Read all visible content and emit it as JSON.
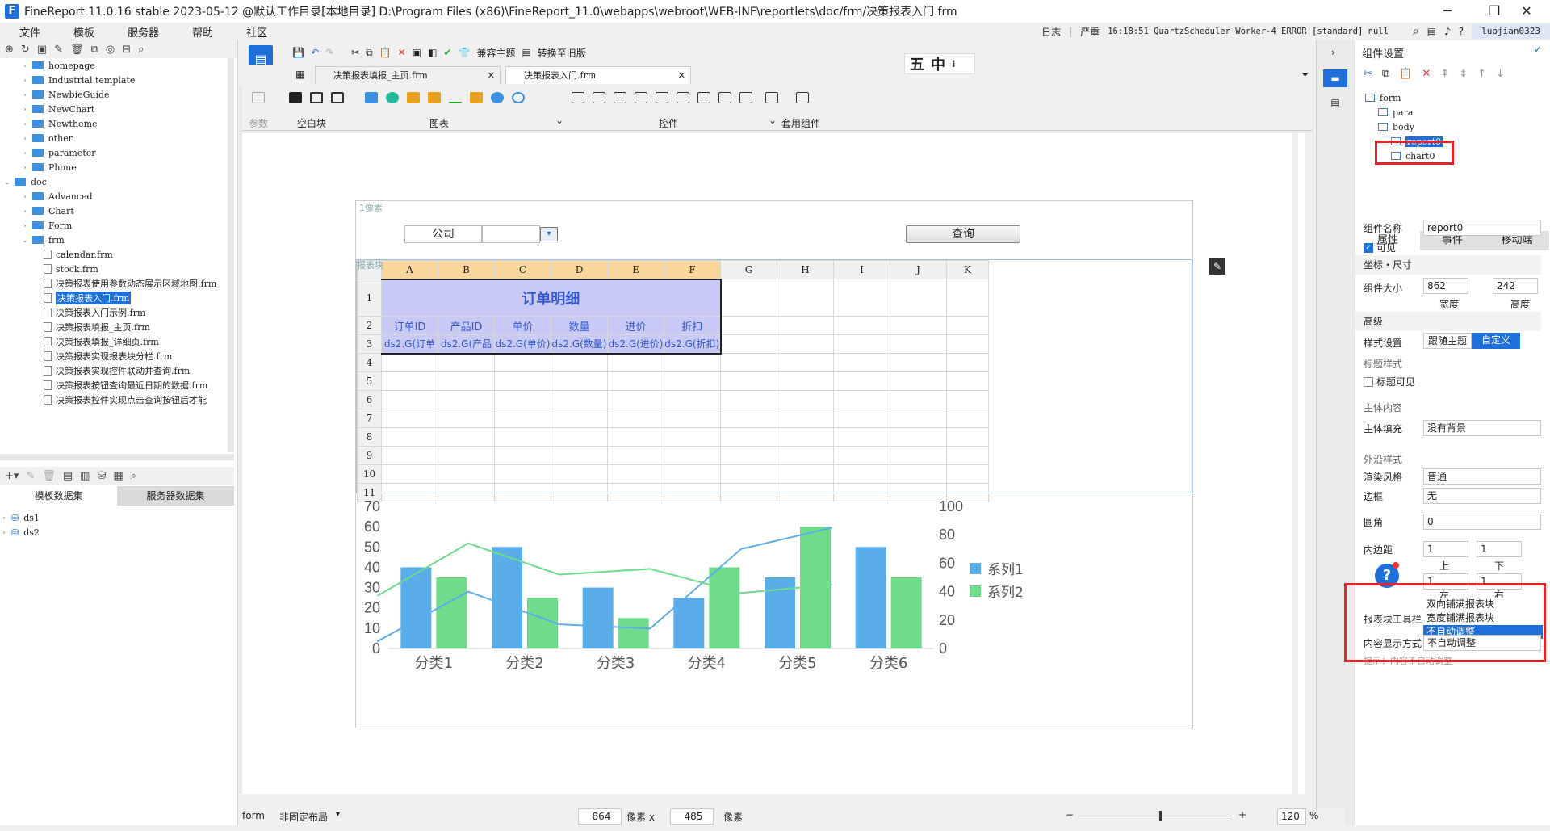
{
  "window": {
    "title": "FineReport 11.0.16 stable 2023-05-12 @默认工作目录[本地目录]    D:\\Program Files (x86)\\FineReport_11.0\\webapps\\webroot\\WEB-INF\\reportlets\\doc/frm/决策报表入门.frm",
    "logo": "F"
  },
  "menu": {
    "items": [
      "文件",
      "模板",
      "服务器",
      "帮助",
      "社区"
    ],
    "log_label": "日志",
    "severity": "严重",
    "log_text": "16:18:51 QuartzScheduler_Worker-4 ERROR [standard] null",
    "user": "luojian0323"
  },
  "tree": {
    "items": [
      {
        "label": "homepage",
        "type": "folder",
        "indent": 1,
        "expanded": false
      },
      {
        "label": "Industrial template",
        "type": "folder",
        "indent": 1,
        "expanded": false
      },
      {
        "label": "NewbieGuide",
        "type": "folder",
        "indent": 1,
        "expanded": false
      },
      {
        "label": "NewChart",
        "type": "folder",
        "indent": 1,
        "expanded": false
      },
      {
        "label": "Newtheme",
        "type": "folder",
        "indent": 1,
        "expanded": false
      },
      {
        "label": "other",
        "type": "folder",
        "indent": 1,
        "expanded": false
      },
      {
        "label": "parameter",
        "type": "folder",
        "indent": 1,
        "expanded": false
      },
      {
        "label": "Phone",
        "type": "folder",
        "indent": 1,
        "expanded": false
      },
      {
        "label": "doc",
        "type": "folder",
        "indent": 0,
        "expanded": true
      },
      {
        "label": "Advanced",
        "type": "folder",
        "indent": 1,
        "expanded": false
      },
      {
        "label": "Chart",
        "type": "folder",
        "indent": 1,
        "expanded": false
      },
      {
        "label": "Form",
        "type": "folder",
        "indent": 1,
        "expanded": false
      },
      {
        "label": "frm",
        "type": "folder",
        "indent": 1,
        "expanded": true
      },
      {
        "label": "calendar.frm",
        "type": "file",
        "indent": 2
      },
      {
        "label": "stock.frm",
        "type": "file",
        "indent": 2
      },
      {
        "label": "决策报表使用参数动态展示区域地图.frm",
        "type": "file",
        "indent": 2
      },
      {
        "label": "决策报表入门.frm",
        "type": "file",
        "indent": 2,
        "selected": true
      },
      {
        "label": "决策报表入门示例.frm",
        "type": "file",
        "indent": 2
      },
      {
        "label": "决策报表填报_主页.frm",
        "type": "file",
        "indent": 2
      },
      {
        "label": "决策报表填报_详细页.frm",
        "type": "file",
        "indent": 2
      },
      {
        "label": "决策报表实现报表块分栏.frm",
        "type": "file",
        "indent": 2
      },
      {
        "label": "决策报表实现控件联动并查询.frm",
        "type": "file",
        "indent": 2
      },
      {
        "label": "决策报表按钮查询最近日期的数据.frm",
        "type": "file",
        "indent": 2
      },
      {
        "label": "决策报表控件实现点击查询按钮后才能",
        "type": "file",
        "indent": 2
      }
    ]
  },
  "datasets": {
    "tabs": [
      "模板数据集",
      "服务器数据集"
    ],
    "items": [
      "ds1",
      "ds2"
    ]
  },
  "toolbar": {
    "theme_label": "兼容主题",
    "convert_label": "转换至旧版"
  },
  "doc_tabs": [
    "决策报表填报_主页.frm",
    "决策报表入门.frm"
  ],
  "ime": [
    "五",
    "中"
  ],
  "components": {
    "params_label": "参数",
    "blank_label": "空白块",
    "chart_label": "图表",
    "widget_label": "控件",
    "template_label": "套用组件"
  },
  "form": {
    "param_hint": "1像素",
    "company_label": "公司",
    "query_label": "查询",
    "report_tag": "报表块"
  },
  "report": {
    "col_headers": [
      "A",
      "B",
      "C",
      "D",
      "E",
      "F",
      "G",
      "H",
      "I",
      "J",
      "K"
    ],
    "row_numbers": [
      "1",
      "2",
      "3",
      "4",
      "5",
      "6",
      "7",
      "8",
      "9",
      "10",
      "11"
    ],
    "title": "订单明细",
    "headers": [
      "订单ID",
      "产品ID",
      "单价",
      "数量",
      "进价",
      "折扣"
    ],
    "cells": [
      "ds2.G(订单",
      "ds2.G(产品",
      "ds2.G(单价)",
      "ds2.G(数量)",
      "ds2.G(进价)",
      "ds2.G(折扣)"
    ]
  },
  "chart_data": {
    "type": "bar",
    "categories": [
      "分类1",
      "分类2",
      "分类3",
      "分类4",
      "分类5",
      "分类6"
    ],
    "series": [
      {
        "name": "系列1",
        "values": [
          40,
          50,
          30,
          25,
          35,
          50
        ],
        "color": "#5aade9"
      },
      {
        "name": "系列2",
        "values": [
          35,
          25,
          15,
          40,
          60,
          35
        ],
        "color": "#6fdc8c"
      }
    ],
    "lines": [
      {
        "name": "系列1",
        "axis": "right",
        "values": [
          5,
          40,
          17,
          14,
          70,
          85
        ],
        "color": "#5aade9"
      },
      {
        "name": "系列2",
        "axis": "right",
        "values": [
          37,
          74,
          52,
          56,
          39,
          45
        ],
        "color": "#6fdc8c"
      }
    ],
    "y_left_ticks": [
      "0",
      "10",
      "20",
      "30",
      "40",
      "50",
      "60",
      "70"
    ],
    "y_right_ticks": [
      "0",
      "20",
      "40",
      "60",
      "80",
      "100"
    ],
    "ylim_left": [
      0,
      70
    ],
    "ylim_right": [
      0,
      100
    ],
    "legend_position": "right"
  },
  "right_panel": {
    "title": "组件设置",
    "tree": [
      {
        "label": "form",
        "indent": 0
      },
      {
        "label": "para",
        "indent": 1
      },
      {
        "label": "body",
        "indent": 1
      },
      {
        "label": "report0",
        "indent": 2,
        "selected": true
      },
      {
        "label": "chart0",
        "indent": 2
      }
    ],
    "tabs": [
      "属性",
      "事件",
      "移动端"
    ],
    "name_label": "组件名称",
    "name_value": "report0",
    "visible_label": "可见",
    "coord_section": "坐标・尺寸",
    "size_label": "组件大小",
    "width_value": "862",
    "height_value": "242",
    "width_label": "宽度",
    "height_label": "高度",
    "advanced_section": "高级",
    "style_label": "样式设置",
    "style_follow": "跟随主题",
    "style_custom": "自定义",
    "title_style_label": "标题样式",
    "title_visible_label": "标题可见",
    "body_section": "主体内容",
    "body_fill_label": "主体填充",
    "body_fill_value": "没有背景",
    "border_section": "外沿样式",
    "render_label": "渲染风格",
    "render_value": "普通",
    "border_label": "边框",
    "border_value": "无",
    "radius_label": "圆角",
    "radius_value": "0",
    "padding_label": "内边距",
    "pad_top": "1",
    "pad_bottom": "1",
    "pad_left": "1",
    "pad_right": "1",
    "up": "上",
    "down": "下",
    "left": "左",
    "right": "右",
    "toolbar_label": "报表块工具栏",
    "dropdown_options": [
      "双向铺满报表块",
      "宽度铺满报表块",
      "不自动调整"
    ],
    "display_label": "内容显示方式",
    "display_value": "不自动调整",
    "hint": "提示：内容不自动调整"
  },
  "status": {
    "mode": "form",
    "layout": "非固定布局",
    "width": "864",
    "px_x": "像素  x",
    "height": "485",
    "px": "像素",
    "zoom": "120",
    "pct": "%"
  }
}
